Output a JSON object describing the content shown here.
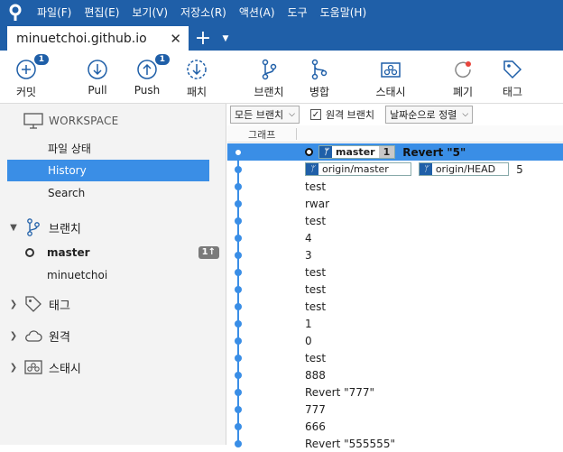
{
  "menubar": {
    "items": [
      "파일(F)",
      "편집(E)",
      "보기(V)",
      "저장소(R)",
      "액션(A)",
      "도구",
      "도움말(H)"
    ]
  },
  "tab": {
    "title": "minuetchoi.github.io",
    "close": "✕",
    "add": "+",
    "dropdown": "▼"
  },
  "toolbar": {
    "commit": {
      "label": "커밋",
      "badge": "1",
      "icon": "commit-plus-icon"
    },
    "pull": {
      "label": "Pull",
      "icon": "pull-arrow-icon"
    },
    "push": {
      "label": "Push",
      "badge": "1",
      "icon": "push-arrow-icon"
    },
    "fetch": {
      "label": "패치",
      "icon": "fetch-icon"
    },
    "branch": {
      "label": "브랜치",
      "icon": "branch-icon"
    },
    "merge": {
      "label": "병합",
      "icon": "merge-icon"
    },
    "stash": {
      "label": "스태시",
      "icon": "stash-icon"
    },
    "discard": {
      "label": "폐기",
      "icon": "discard-icon"
    },
    "tag": {
      "label": "태그",
      "icon": "tag-icon"
    }
  },
  "sidebar": {
    "workspace_header": "WORKSPACE",
    "workspace_items": [
      "파일 상태",
      "History",
      "Search"
    ],
    "selected_item": "History",
    "branches_header": "브랜치",
    "branches": [
      {
        "name": "master",
        "current": true,
        "ahead": "1↑"
      },
      {
        "name": "minuetchoi",
        "current": false
      }
    ],
    "tags_header": "태그",
    "remotes_header": "원격",
    "stashes_header": "스태시"
  },
  "filters": {
    "branch_filter": "모든 브랜치",
    "remote_branches_label": "원격 브랜치",
    "remote_branches_checked": true,
    "sort": "날짜순으로 정렬"
  },
  "columns": {
    "graph": "그래프"
  },
  "commits": [
    {
      "refs": [
        {
          "name": "master",
          "ahead": "1"
        }
      ],
      "message": "Revert \"5\"",
      "head": true
    },
    {
      "refs": [
        {
          "name": "origin/master"
        },
        {
          "name": "origin/HEAD"
        }
      ],
      "message": "5"
    },
    {
      "message": "test"
    },
    {
      "message": "rwar"
    },
    {
      "message": "test"
    },
    {
      "message": "4"
    },
    {
      "message": "3"
    },
    {
      "message": "test"
    },
    {
      "message": "test"
    },
    {
      "message": "test"
    },
    {
      "message": "1"
    },
    {
      "message": "0"
    },
    {
      "message": "test"
    },
    {
      "message": "888"
    },
    {
      "message": "Revert \"777\""
    },
    {
      "message": "777"
    },
    {
      "message": "666"
    },
    {
      "message": "Revert \"555555\""
    }
  ],
  "colors": {
    "accent": "#1f5fa8",
    "selection": "#3a8ee6",
    "graph": "#3a8ee6"
  }
}
